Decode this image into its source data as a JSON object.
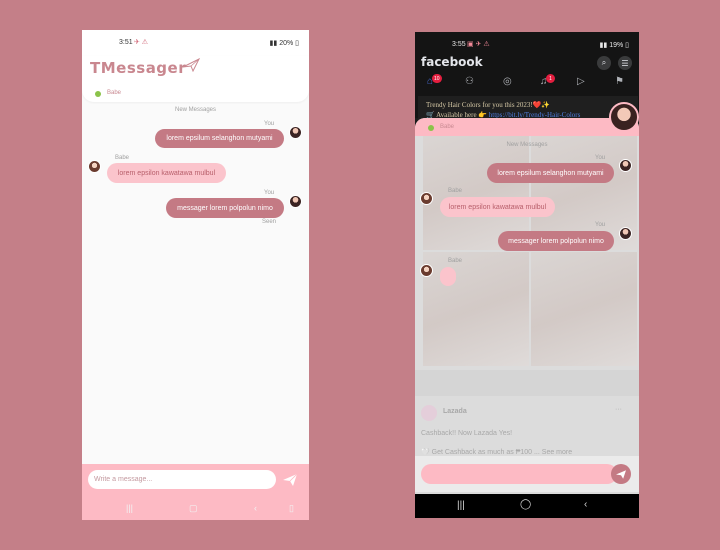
{
  "left_phone": {
    "status": {
      "time": "3:51",
      "battery": "20%"
    },
    "app_title": "TMessager",
    "contact": {
      "name": "Babe",
      "online_color": "#8bc34a"
    },
    "divider": "New Messages",
    "messages": [
      {
        "direction": "sent",
        "meta": "You",
        "text": "lorem epsilum selanghon mutyami"
      },
      {
        "direction": "received",
        "meta": "Babe",
        "text": "lorem epsilon kawatawa mulbul"
      },
      {
        "direction": "sent",
        "meta": "You",
        "text": "messager lorem polpolun nimo",
        "status": "Seen"
      }
    ],
    "composer": {
      "placeholder": "Write a message..."
    },
    "colors": {
      "background": "#c47f88",
      "accent_pink": "#fdbac4",
      "sent_bubble": "#c47a84",
      "received_bubble": "#fbc4cc"
    }
  },
  "right_phone": {
    "status": {
      "time": "3:55",
      "battery": "19%"
    },
    "facebook": {
      "logo": "facebook",
      "tabs": [
        {
          "icon": "home-icon",
          "badge": "10"
        },
        {
          "icon": "friends-icon"
        },
        {
          "icon": "messenger-icon"
        },
        {
          "icon": "bell-icon",
          "badge": "1"
        },
        {
          "icon": "video-icon"
        },
        {
          "icon": "flag-icon"
        }
      ],
      "post_line1": "Trendy Hair Colors for you this 2023!❤️✨",
      "post_line2_prefix": "🛒 Available here 👉",
      "post_line2_link": "https://bit.ly/Trendy-Hair-Colors",
      "sponsor_name": "Lazada",
      "sponsor_line1": "Cashback!! Now Lazada Yes!",
      "sponsor_line2": "🤍 Get Cashback as much as ₱100 ... See more"
    },
    "overlay": {
      "contact": {
        "name": "Babe"
      },
      "divider": "New Messages",
      "messages": [
        {
          "direction": "sent",
          "meta": "You",
          "text": "lorem epsilum selanghon mutyami"
        },
        {
          "direction": "received",
          "meta": "Babe",
          "text": "lorem epsilon kawatawa mulbul"
        },
        {
          "direction": "sent",
          "meta": "You",
          "text": "messager lorem polpolun nimo"
        },
        {
          "direction": "received",
          "meta": "Babe",
          "text": ""
        }
      ]
    }
  }
}
